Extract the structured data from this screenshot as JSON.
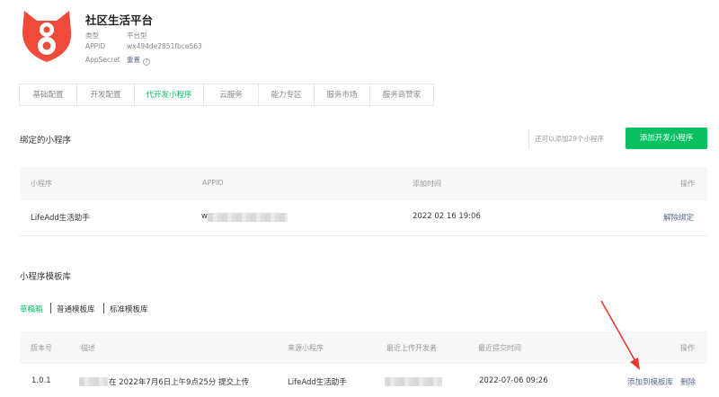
{
  "app": {
    "name": "社区生活平台",
    "type_label": "类型",
    "type_value": "平台型",
    "appid_label": "APPID",
    "appid_value": "wx494de2851fbce563",
    "secret_label": "AppSecret",
    "secret_action": "重置",
    "brand_color": "#f04a3a"
  },
  "tabs": [
    {
      "label": "基础配置",
      "active": false
    },
    {
      "label": "开发配置",
      "active": false
    },
    {
      "label": "代开发小程序",
      "active": true
    },
    {
      "label": "云服务",
      "active": false
    },
    {
      "label": "能力专区",
      "active": false
    },
    {
      "label": "服务市场",
      "active": false
    },
    {
      "label": "服务商赞家",
      "active": false
    }
  ],
  "bound": {
    "title": "绑定的小程序",
    "remain_text": "还可以添加29个小程序",
    "add_button": "添加开发小程序",
    "columns": {
      "name": "小程序",
      "appid": "APPID",
      "time": "添加时间",
      "ops": "操作"
    },
    "rows": [
      {
        "name": "LifeAdd生活助手",
        "appid_prefix": "w",
        "time": "2022 02 16 19:06",
        "action": "解除绑定"
      }
    ]
  },
  "templates": {
    "title": "小程序模板库",
    "filters": [
      "草稿箱",
      "普通模板库",
      "标准模板库"
    ],
    "columns": {
      "version": "版本号",
      "desc": "描述",
      "source": "来源小程序",
      "developer": "最近上传开发者",
      "time": "最近提交时间",
      "ops": "操作"
    },
    "rows": [
      {
        "version": "1.0.1",
        "desc": "在 2022年7月6日上午9点25分 提交上传",
        "source": "LifeAdd生活助手",
        "time": "2022-07-06 09:26",
        "action_add": "添加到模板库",
        "action_delete": "删除"
      }
    ]
  },
  "colors": {
    "accent": "#07c160",
    "link": "#576b95",
    "arrow": "#e53935"
  }
}
